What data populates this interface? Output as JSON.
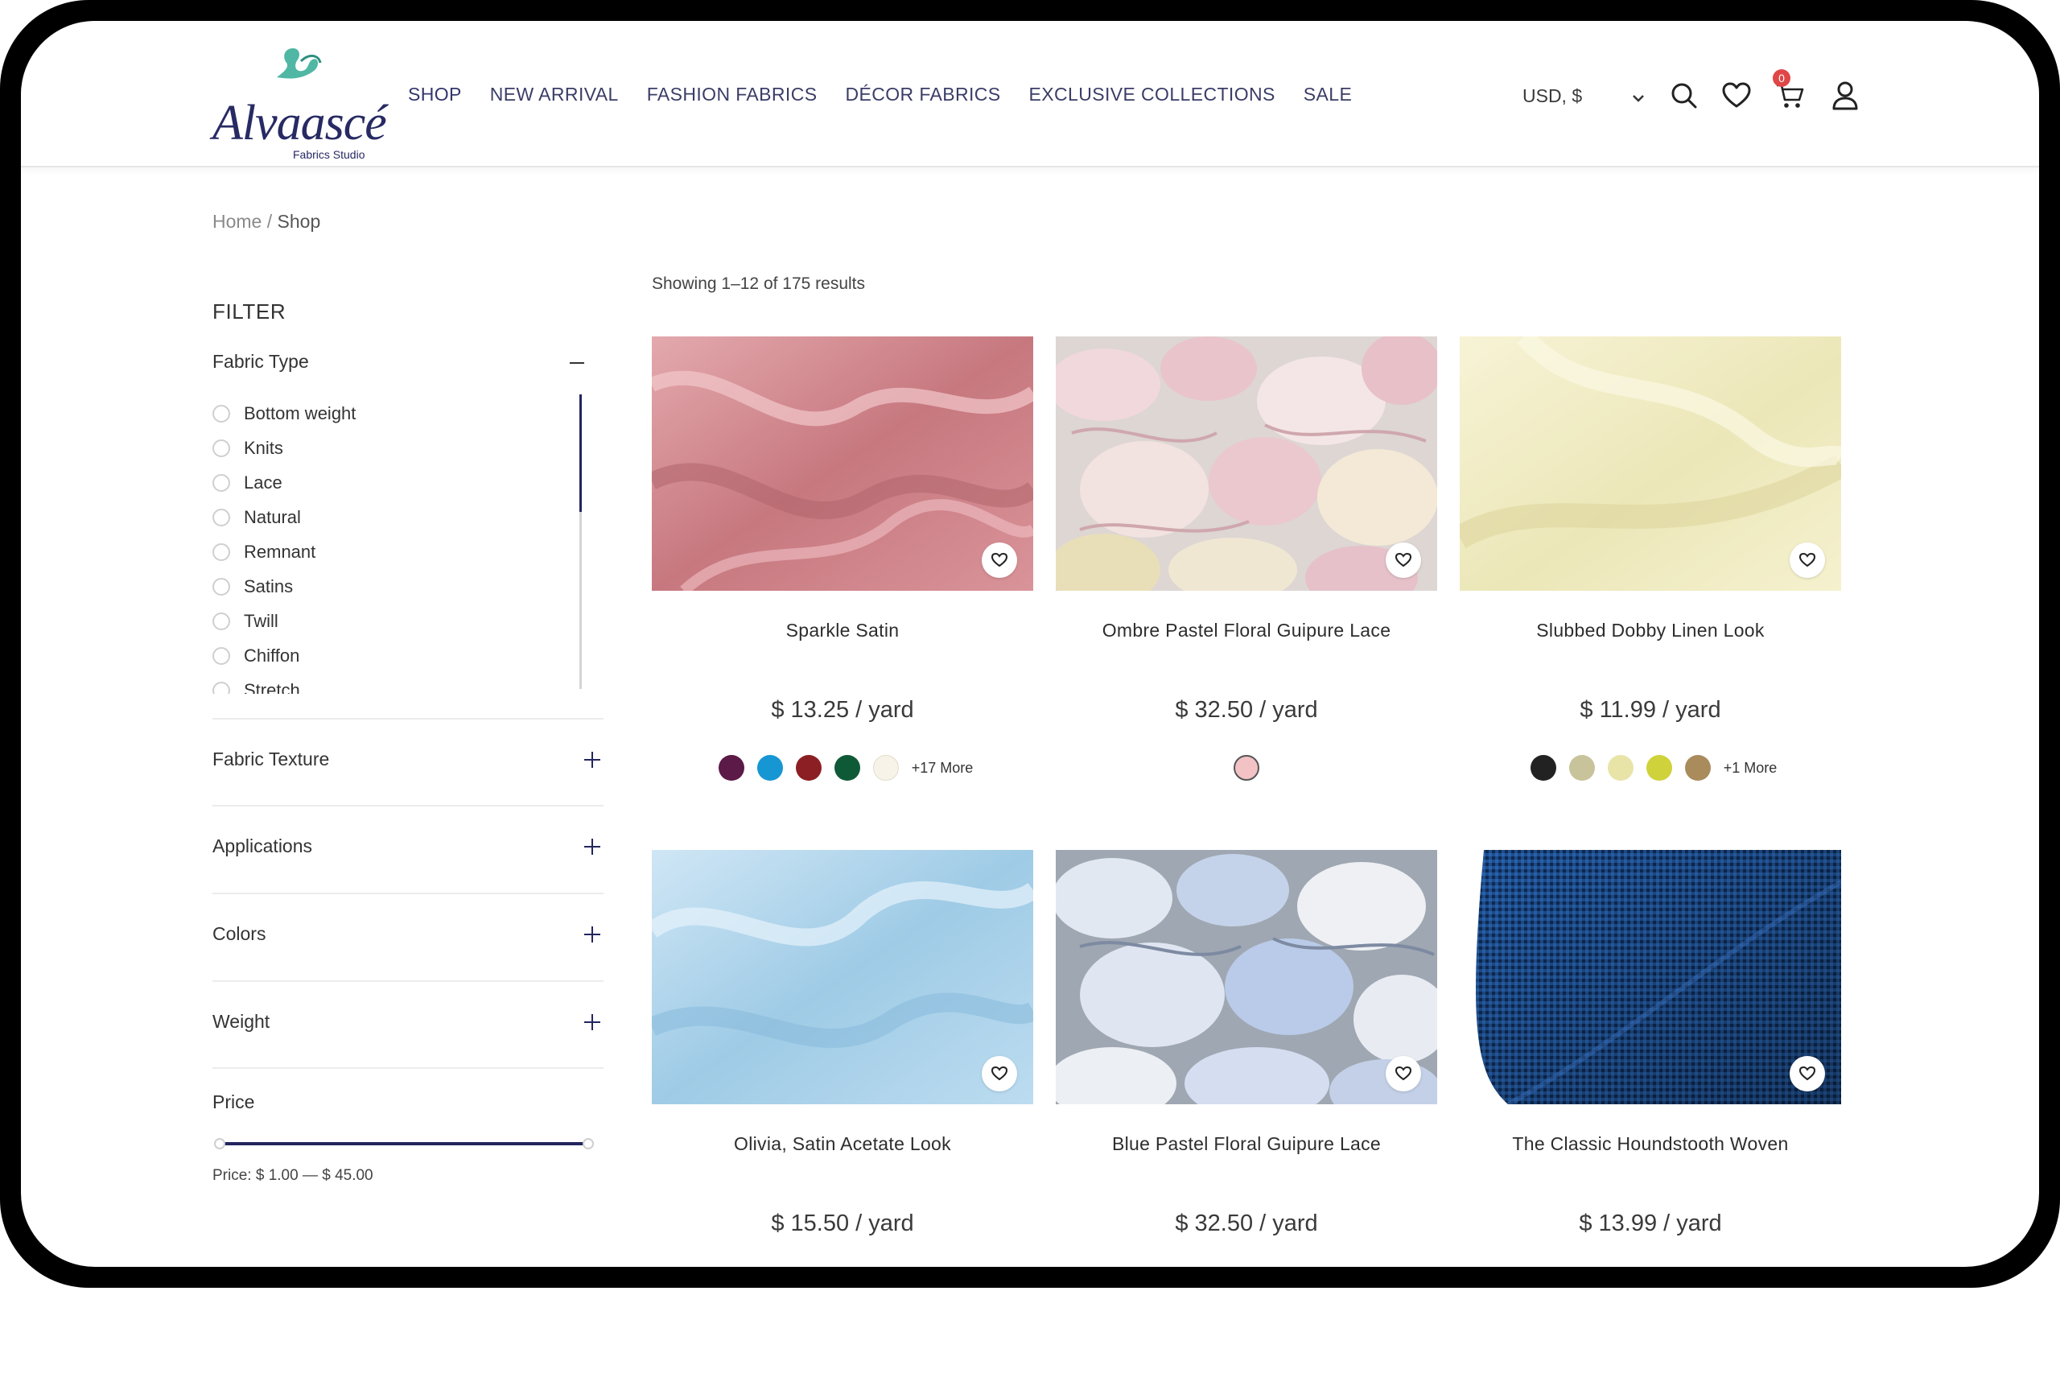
{
  "brand": {
    "name": "Alvaascé",
    "subtitle": "Fabrics Studio"
  },
  "nav": [
    "SHOP",
    "NEW ARRIVAL",
    "FASHION FABRICS",
    "DÉCOR FABRICS",
    "EXCLUSIVE COLLECTIONS",
    "SALE"
  ],
  "header": {
    "currency": "USD, $",
    "cart_count": "0"
  },
  "breadcrumb": {
    "home": "Home",
    "sep": "/",
    "current": "Shop"
  },
  "filter": {
    "title": "FILTER",
    "fabric_type": {
      "label": "Fabric Type",
      "options": [
        "Bottom weight",
        "Knits",
        "Lace",
        "Natural",
        "Remnant",
        "Satins",
        "Twill",
        "Chiffon",
        "Stretch"
      ]
    },
    "sections": [
      "Fabric Texture",
      "Applications",
      "Colors",
      "Weight"
    ],
    "price": {
      "label": "Price",
      "range_text": "Price: $ 1.00 — $ 45.00",
      "min": 1.0,
      "max": 45.0
    }
  },
  "results": {
    "showing": "Showing 1–12 of 175 results"
  },
  "products": [
    {
      "name": "Sparkle Satin",
      "price": "$ 13.25 / yard",
      "swatches": [
        "#5b1a47",
        "#1796d4",
        "#8c1f23",
        "#0e5a36",
        "#f7f3e8"
      ],
      "more": "+17 More"
    },
    {
      "name": "Ombre Pastel Floral Guipure Lace",
      "price": "$ 32.50 / yard",
      "swatches": [
        "#f2c2c4"
      ],
      "more": ""
    },
    {
      "name": "Slubbed Dobby Linen Look",
      "price": "$ 11.99 / yard",
      "swatches": [
        "#222222",
        "#c8c39a",
        "#e8e4a8",
        "#cfd23a",
        "#a98b5c"
      ],
      "more": "+1 More"
    },
    {
      "name": "Olivia, Satin Acetate Look",
      "price": "$ 15.50 / yard",
      "swatches": [],
      "more": ""
    },
    {
      "name": "Blue Pastel Floral Guipure Lace",
      "price": "$ 32.50 / yard",
      "swatches": [],
      "more": ""
    },
    {
      "name": "The Classic Houndstooth Woven",
      "price": "$ 13.99 / yard",
      "swatches": [],
      "more": ""
    }
  ]
}
